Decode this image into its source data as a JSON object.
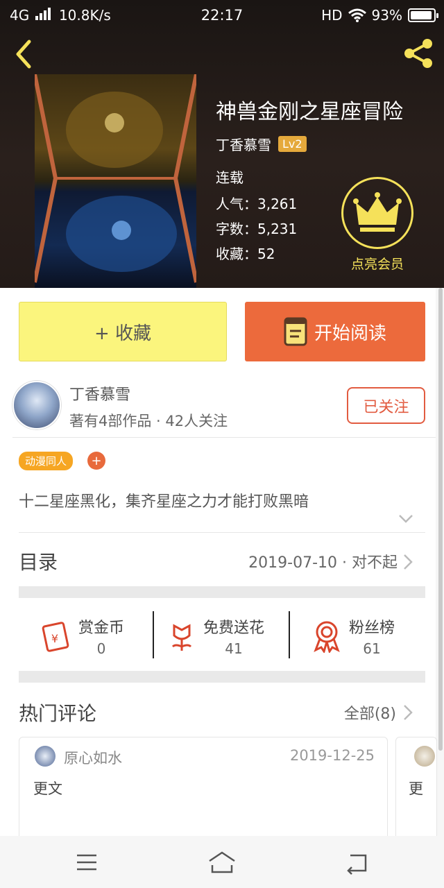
{
  "status_bar": {
    "network": "4G",
    "speed": "10.8K/s",
    "time": "22:17",
    "hd": "HD",
    "battery": "93%",
    "battery_level": 0.93
  },
  "header": {
    "back_icon": "chevron-left-icon",
    "share_icon": "share-icon"
  },
  "book": {
    "title": "神兽金刚之星座冒险",
    "author": "丁香慕雪",
    "level": "Lv2",
    "status": "连载",
    "popularity": "人气：3,261",
    "words": "字数：5,231",
    "favorites": "收藏：52",
    "vip_label": "点亮会员"
  },
  "actions": {
    "favorite_label": "+ 收藏",
    "read_label": "开始阅读"
  },
  "author_info": {
    "name": "丁香慕雪",
    "summary": "著有4部作品 · 42人关注",
    "follow_label": "已关注"
  },
  "tags": [
    "动漫同人"
  ],
  "tag_add": "+",
  "description": "十二星座黑化，集齐星座之力才能打败黑暗",
  "toc": {
    "label": "目录",
    "latest": "2019-07-10 · 对不起"
  },
  "rewards": [
    {
      "label": "赏金币",
      "value": "0",
      "icon": "red-envelope-icon"
    },
    {
      "label": "免费送花",
      "value": "41",
      "icon": "flower-icon"
    },
    {
      "label": "粉丝榜",
      "value": "61",
      "icon": "medal-icon"
    }
  ],
  "comments": {
    "label": "热门评论",
    "all_label": "全部(8)",
    "items": [
      {
        "user": "原心如水",
        "date": "2019-12-25",
        "text": "更文"
      },
      {
        "text": "更"
      }
    ]
  },
  "colors": {
    "accent": "#ec6a3c",
    "favorite_bg": "#fbf57d",
    "gold": "#f5e15a",
    "tag": "#f6a623"
  }
}
